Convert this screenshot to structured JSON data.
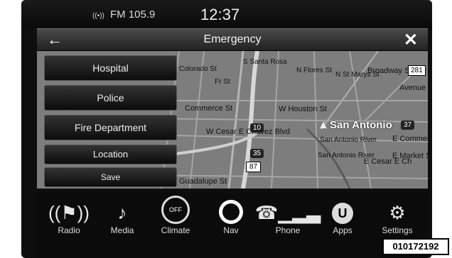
{
  "status": {
    "radio": "FM 105.9",
    "clock": "12:37"
  },
  "header": {
    "title": "Emergency",
    "back_icon": "arrow-left-icon",
    "close_icon": "close-icon"
  },
  "menu": [
    {
      "label": "Hospital"
    },
    {
      "label": "Police"
    },
    {
      "label": "Fire Department"
    },
    {
      "label": "Location"
    },
    {
      "label": "Save"
    }
  ],
  "map": {
    "city": "San Antonio",
    "labels": [
      "Commerce St",
      "W Houston St",
      "W Cesar E Chavez Blvd",
      "San Antonio River",
      "San Antonio River",
      "E Commerce",
      "Broadway St",
      "Avenue E",
      "N Flores St",
      "N St Marys St",
      "Fr St",
      "S Santa Rosa",
      "Guadalupe St",
      "E Cesar E Ch",
      "E Market St",
      "Colorado St"
    ],
    "shields": [
      "10",
      "35",
      "87",
      "37",
      "281"
    ]
  },
  "bottom_nav": [
    {
      "label": "Radio",
      "icon": "radio-icon"
    },
    {
      "label": "Media",
      "icon": "media-icon"
    },
    {
      "label": "Climate",
      "icon": "climate-icon",
      "badge": "OFF"
    },
    {
      "label": "Nav",
      "icon": "nav-icon"
    },
    {
      "label": "Phone",
      "icon": "phone-icon"
    },
    {
      "label": "Apps",
      "icon": "apps-icon"
    },
    {
      "label": "Settings",
      "icon": "settings-icon"
    }
  ],
  "image_id": "010172192"
}
